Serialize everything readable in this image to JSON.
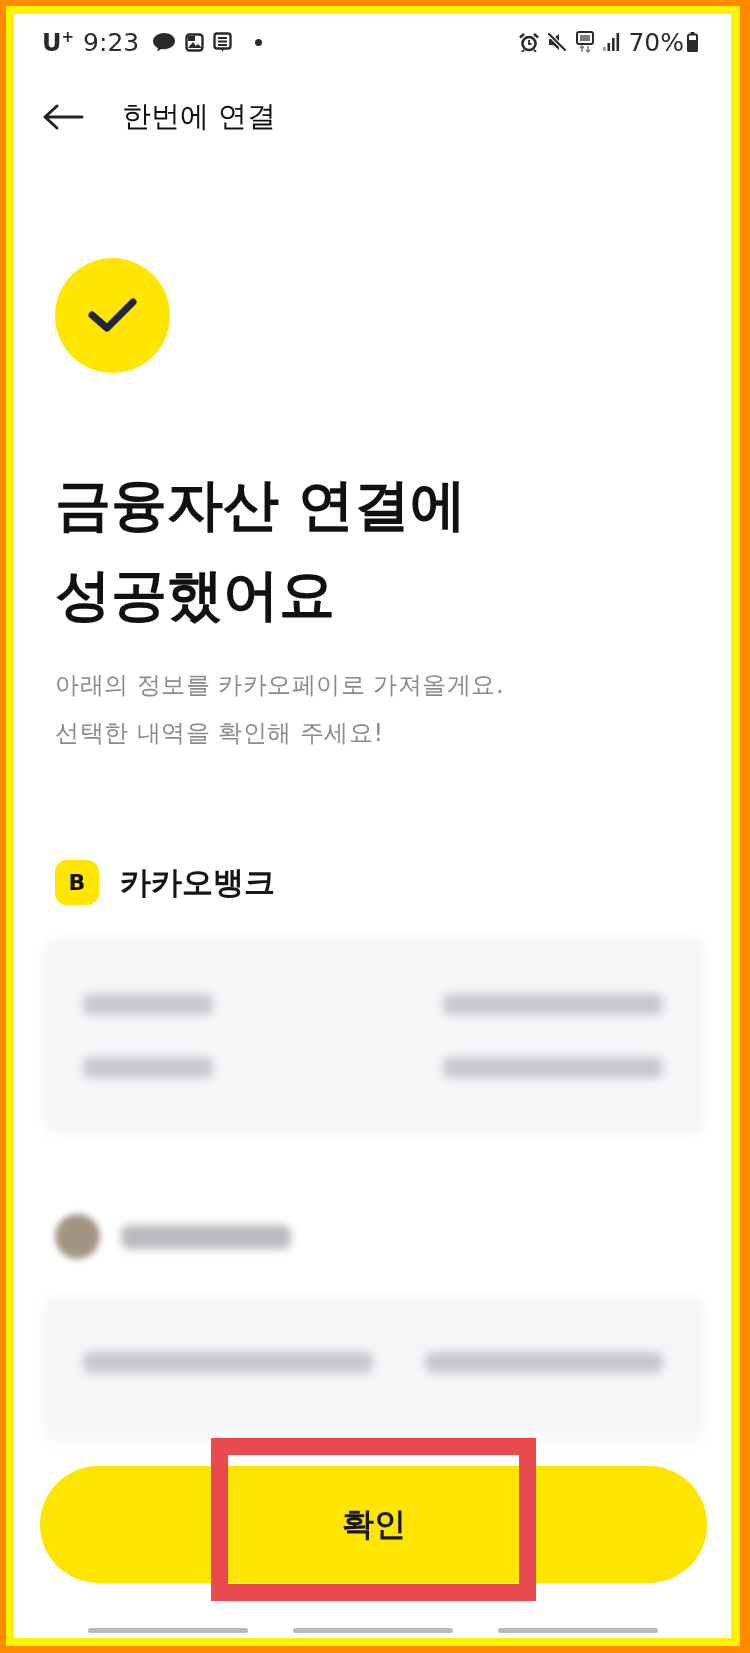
{
  "status_bar": {
    "carrier": "U$^{+}$",
    "time": "9:23",
    "battery": "70%"
  },
  "header": {
    "title": "한번에 연결"
  },
  "result": {
    "title": "금융자산 연결에\n성공했어요",
    "description": "아래의 정보를 카카오페이로 가져올게요.\n선택한 내역을 확인해 주세요!"
  },
  "sections": [
    {
      "kind": "bank",
      "logo": "B",
      "name": "카카오뱅크"
    },
    {
      "kind": "blurred"
    }
  ],
  "confirm_button": {
    "label": "확인",
    "highlighted": true
  }
}
